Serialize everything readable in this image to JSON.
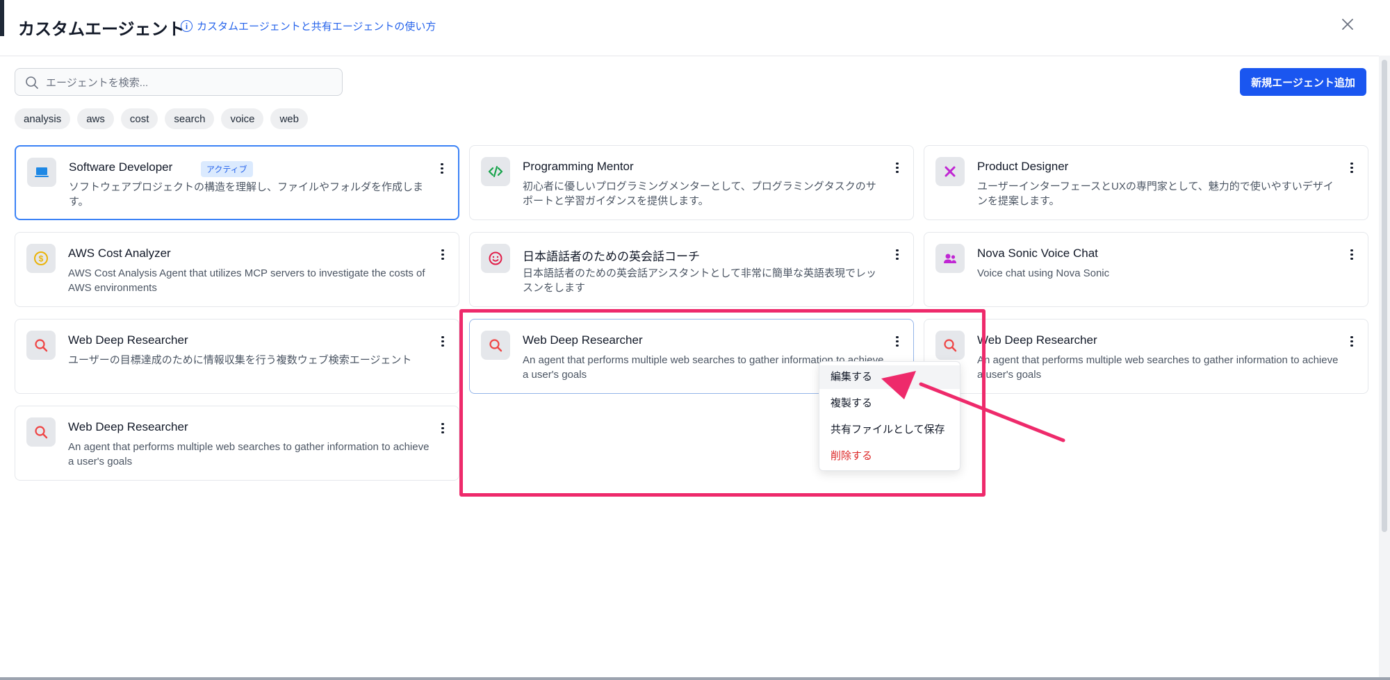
{
  "header": {
    "title": "カスタムエージェント",
    "help_link": "カスタムエージェントと共有エージェントの使い方",
    "close_label": "×"
  },
  "search": {
    "placeholder": "エージェントを検索..."
  },
  "add_button": "新規エージェント追加",
  "tags": [
    "analysis",
    "aws",
    "cost",
    "search",
    "voice",
    "web"
  ],
  "cards": [
    {
      "name": "Software Developer",
      "badge": "アクティブ",
      "desc": "ソフトウェアプロジェクトの構造を理解し、ファイルやフォルダを作成します。",
      "icon": "laptop-icon"
    },
    {
      "name": "Programming Mentor",
      "desc": "初心者に優しいプログラミングメンターとして、プログラミングタスクのサポートと学習ガイダンスを提供します。",
      "icon": "code-icon"
    },
    {
      "name": "Product Designer",
      "desc": "ユーザーインターフェースとUXの専門家として、魅力的で使いやすいデザインを提案します。",
      "icon": "design-tools-icon"
    },
    {
      "name": "AWS Cost Analyzer",
      "desc": "AWS Cost Analysis Agent that utilizes MCP servers to investigate the costs of AWS environments",
      "icon": "dollar-coin-icon"
    },
    {
      "name": "日本語話者のための英会話コーチ",
      "desc": "日本語話者のための英会話アシスタントとして非常に簡単な英語表現でレッスンをします",
      "icon": "smile-face-icon"
    },
    {
      "name": "Nova Sonic Voice Chat",
      "desc": "Voice chat using Nova Sonic",
      "icon": "users-icon"
    },
    {
      "name": "Web Deep Researcher",
      "desc": "ユーザーの目標達成のために情報収集を行う複数ウェブ検索エージェント",
      "icon": "search-icon"
    },
    {
      "name": "Web Deep Researcher",
      "desc": "An agent that performs multiple web searches to gather information to achieve a user's goals",
      "icon": "search-icon"
    },
    {
      "name": "Web Deep Researcher",
      "desc": "An agent that performs multiple web searches to gather information to achieve a user's goals",
      "icon": "search-icon"
    },
    {
      "name": "Web Deep Researcher",
      "desc": "An agent that performs multiple web searches to gather information to achieve a user's goals",
      "icon": "search-icon"
    }
  ],
  "context_menu": {
    "edit": "編集する",
    "duplicate": "複製する",
    "save_shared": "共有ファイルとして保存",
    "delete": "削除する"
  },
  "colors": {
    "accent": "#1a56f0",
    "highlight": "#ee2a6b",
    "danger": "#dc2626"
  }
}
